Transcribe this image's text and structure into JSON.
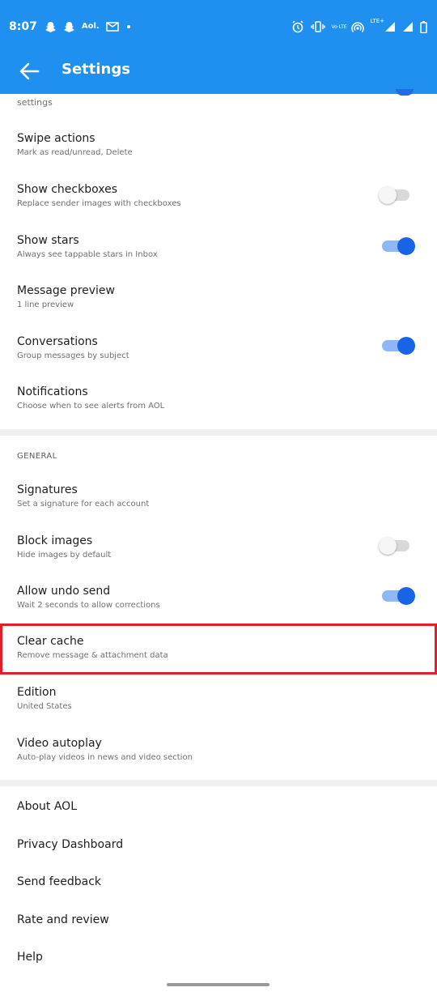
{
  "status_bar": {
    "time": "8:07",
    "left_icons": [
      "snapchat-icon",
      "snapchat-icon",
      "aol-text",
      "email-icon",
      "dot-icon"
    ],
    "aol_text": "Aol.",
    "right_icons": [
      "alarm-icon",
      "vibrate-icon",
      "volte-icon",
      "hotspot-icon",
      "lte-signal-icon",
      "signal-icon",
      "battery-icon"
    ],
    "volte_text": "Vo·LTE",
    "lte_text": "LTE+"
  },
  "app_bar": {
    "title": "Settings"
  },
  "clipped_row": {
    "subtitle": "settings"
  },
  "rows": [
    {
      "title": "Swipe actions",
      "subtitle": "Mark as read/unread, Delete"
    },
    {
      "title": "Show checkboxes",
      "subtitle": "Replace sender images with checkboxes",
      "toggle": "off"
    },
    {
      "title": "Show stars",
      "subtitle": "Always see tappable stars in Inbox",
      "toggle": "on"
    },
    {
      "title": "Message preview",
      "subtitle": "1 line preview"
    },
    {
      "title": "Conversations",
      "subtitle": "Group messages by subject",
      "toggle": "on"
    },
    {
      "title": "Notifications",
      "subtitle": "Choose when to see alerts from AOL"
    }
  ],
  "general": {
    "header": "GENERAL",
    "rows": [
      {
        "title": "Signatures",
        "subtitle": "Set a signature for each account"
      },
      {
        "title": "Block images",
        "subtitle": "Hide images by default",
        "toggle": "off"
      },
      {
        "title": "Allow undo send",
        "subtitle": "Wait 2 seconds to allow corrections",
        "toggle": "on"
      },
      {
        "title": "Clear cache",
        "subtitle": "Remove message & attachment data"
      },
      {
        "title": "Edition",
        "subtitle": "United States"
      },
      {
        "title": "Video autoplay",
        "subtitle": "Auto-play videos in news and video section"
      }
    ]
  },
  "footer_rows": [
    {
      "title": "About AOL"
    },
    {
      "title": "Privacy Dashboard"
    },
    {
      "title": "Send feedback"
    },
    {
      "title": "Rate and review"
    },
    {
      "title": "Help"
    }
  ],
  "colors": {
    "accent": "#1f8ff0",
    "toggle_on": "#1764e8",
    "highlight": "#e11e2b"
  }
}
